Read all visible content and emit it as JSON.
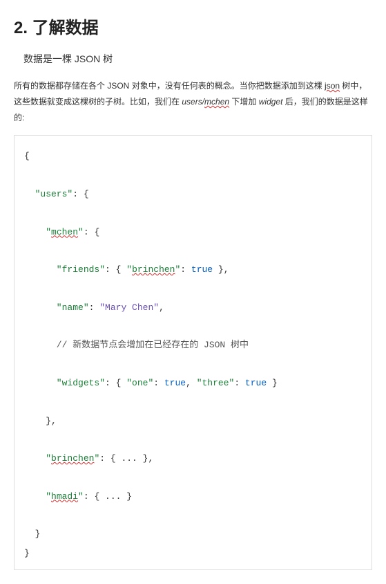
{
  "heading": "2.  了解数据",
  "subheading_pre": "数据是一棵 ",
  "subheading_json": "JSON",
  "subheading_post": " 树",
  "para": {
    "t1": "所有的数据都存储在各个 ",
    "json1": "JSON",
    "t2": " 对象中，没有任何表的概念。当你把数据添加到这棵 ",
    "json_wavy": "json",
    "t3": " 树中，这些数据就变成这棵树的子树。比如，我们在 ",
    "italic1": "users/",
    "italic_wavy": "mchen",
    "t4": " 下增加 ",
    "italic2": "widget",
    "t5": " 后，我们的数据是这样的:"
  },
  "code": {
    "open": "{",
    "users_open_a": "  \"users\"",
    "users_open_b": ": {",
    "mchen_open_a": "    \"",
    "mchen_open_key": "mchen",
    "mchen_open_b": "\": {",
    "friends_a": "      \"friends\"",
    "friends_b": ": { ",
    "friends_key_a": "\"",
    "friends_key_wavy": "brinchen",
    "friends_key_b": "\"",
    "friends_c": ": ",
    "friends_true": "true",
    "friends_d": " },",
    "name_a": "      \"name\"",
    "name_b": ": ",
    "name_val": "\"Mary Chen\"",
    "name_c": ",",
    "comment": "      // 新数据节点会增加在已经存在的 JSON 树中",
    "widgets_a": "      \"widgets\"",
    "widgets_b": ": { ",
    "widgets_one": "\"one\"",
    "widgets_c": ": ",
    "widgets_t1": "true",
    "widgets_d": ", ",
    "widgets_three": "\"three\"",
    "widgets_e": ": ",
    "widgets_t2": "true",
    "widgets_f": " }",
    "mchen_close": "    },",
    "brin_a": "    \"",
    "brin_key": "brinchen",
    "brin_b": "\": { ... },",
    "hmadi_a": "    \"",
    "hmadi_key": "hmadi",
    "hmadi_b": "\": { ... }",
    "users_close": "  }",
    "close": "}"
  }
}
